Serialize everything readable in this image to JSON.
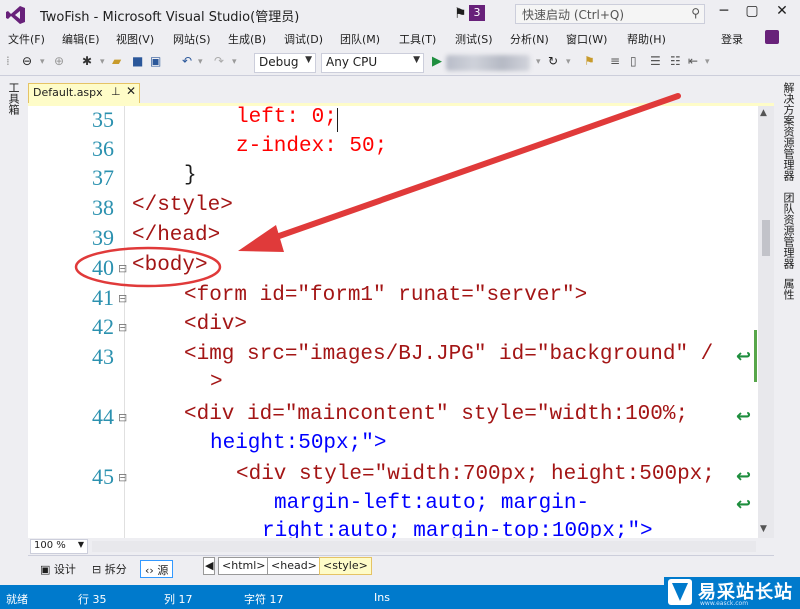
{
  "window": {
    "title": "TwoFish - Microsoft Visual Studio(管理员)",
    "notification_count": "3",
    "quick_launch_placeholder": "快速启动 (Ctrl+Q)",
    "minimize": "─",
    "restore": "▢",
    "close": "✕"
  },
  "menu": {
    "items": [
      "文件(F)",
      "编辑(E)",
      "视图(V)",
      "网站(S)",
      "生成(B)",
      "调试(D)",
      "团队(M)",
      "工具(T)",
      "测试(S)",
      "分析(N)",
      "窗口(W)",
      "帮助(H)"
    ],
    "login": "登录"
  },
  "toolbar": {
    "configuration": "Debug",
    "platform": "Any CPU"
  },
  "left_panel": {
    "toolbox": "工具箱"
  },
  "right_panel": {
    "tabs": [
      "解决方案资源管理器",
      "团队资源管理器",
      "属性"
    ]
  },
  "tab": {
    "label": "Default.aspx",
    "pin": "⊥",
    "close": "✕"
  },
  "editor": {
    "lines": [
      {
        "num": "35",
        "text": "left: 0;"
      },
      {
        "num": "36",
        "text": "z-index: 50;"
      },
      {
        "num": "37",
        "text": "}"
      },
      {
        "num": "38",
        "text": "</style>"
      },
      {
        "num": "39",
        "text": "</head>"
      },
      {
        "num": "40",
        "text": "<body>"
      },
      {
        "num": "41",
        "text": "<form id=\"form1\" runat=\"server\">"
      },
      {
        "num": "42",
        "text": "<div>"
      },
      {
        "num": "43",
        "text": "<img src=\"images/BJ.JPG\" id=\"background\" /"
      },
      {
        "num": "",
        "text": ">"
      },
      {
        "num": "44",
        "text": "<div id=\"maincontent\" style=\"width:100%;"
      },
      {
        "num": "",
        "text": "height:50px;\">"
      },
      {
        "num": "45",
        "text": "<div style=\"width:700px; height:500px;"
      },
      {
        "num": "",
        "text": "margin-left:auto; margin-"
      },
      {
        "num": "",
        "text": "right:auto; margin-top:100px;\">"
      }
    ]
  },
  "zoom": "100 %",
  "views": {
    "design": "设计",
    "split": "拆分",
    "source": "源"
  },
  "breadcrumbs": [
    "<html>",
    "<head>",
    "<style>"
  ],
  "status": {
    "ready": "就绪",
    "row": "行 35",
    "col": "列 17",
    "char": "字符 17",
    "mode": "Ins"
  },
  "watermark": {
    "text": "易采站长站",
    "url": "www.easck.com"
  },
  "colors": {
    "accent": "#007ACC",
    "vs_purple": "#68217A",
    "annotation_red": "#E03A3A",
    "line_number": "#2B91AF",
    "html_tag": "#A31515",
    "attribute": "#FF0000",
    "value": "#0000FF"
  }
}
